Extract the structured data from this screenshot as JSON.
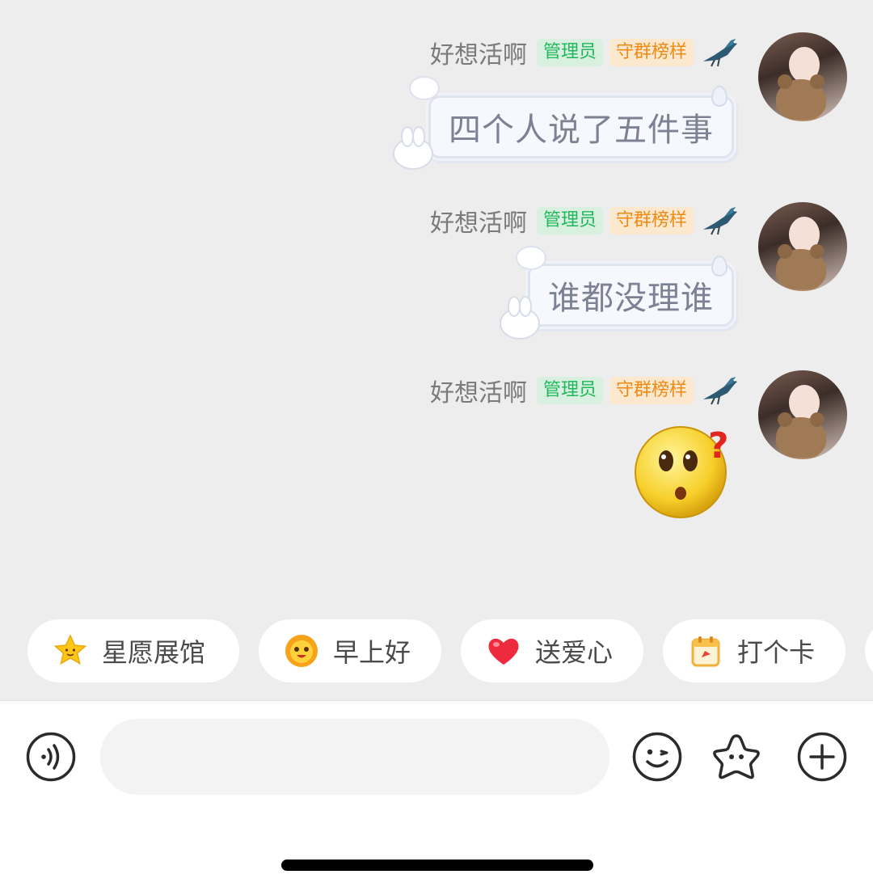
{
  "messages": [
    {
      "sender": "好想活啊",
      "tags": {
        "admin": "管理员",
        "guard": "守群榜样"
      },
      "text": "四个人说了五件事"
    },
    {
      "sender": "好想活啊",
      "tags": {
        "admin": "管理员",
        "guard": "守群榜样"
      },
      "text": "谁都没理谁"
    },
    {
      "sender": "好想活啊",
      "tags": {
        "admin": "管理员",
        "guard": "守群榜样"
      },
      "sticker": "confused-face-emoji"
    }
  ],
  "quick_actions": [
    {
      "label": "星愿展馆",
      "icon": "star-icon"
    },
    {
      "label": "早上好",
      "icon": "sun-icon"
    },
    {
      "label": "送爱心",
      "icon": "heart-icon"
    },
    {
      "label": "打个卡",
      "icon": "calendar-icon"
    }
  ],
  "input": {
    "placeholder": ""
  },
  "colors": {
    "admin_tag": "#1fb85a",
    "guard_tag": "#f08a12",
    "chat_background": "#ededed"
  }
}
